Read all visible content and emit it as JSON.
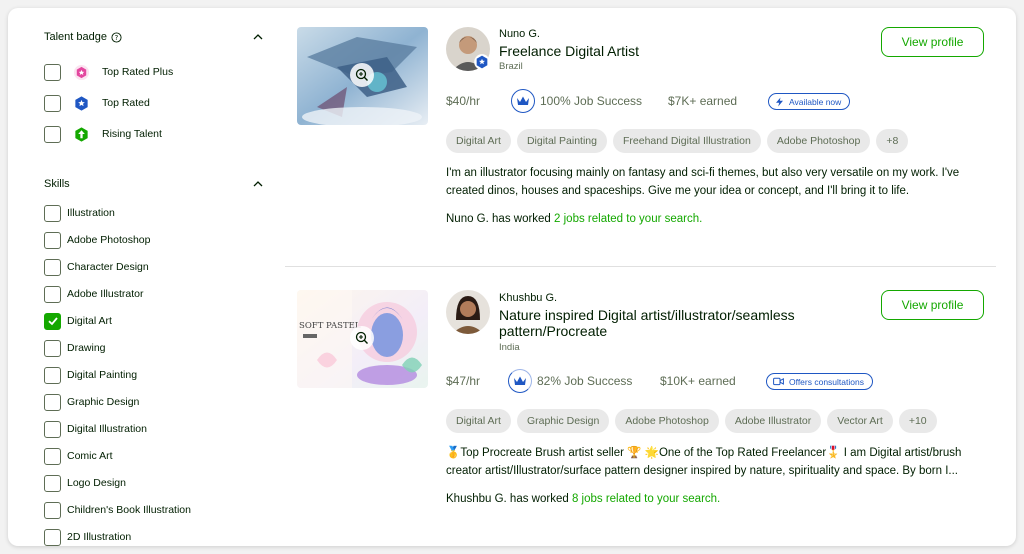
{
  "filters": {
    "talent_badge": {
      "title": "Talent badge",
      "options": [
        {
          "label": "Top Rated Plus",
          "icon": "top-rated-plus-icon",
          "color": "#e3469e",
          "checked": false
        },
        {
          "label": "Top Rated",
          "icon": "top-rated-icon",
          "color": "#1f57c3",
          "checked": false
        },
        {
          "label": "Rising Talent",
          "icon": "rising-talent-icon",
          "color": "#14a800",
          "checked": false
        }
      ]
    },
    "skills": {
      "title": "Skills",
      "options": [
        {
          "label": "Illustration",
          "checked": false
        },
        {
          "label": "Adobe Photoshop",
          "checked": false
        },
        {
          "label": "Character Design",
          "checked": false
        },
        {
          "label": "Adobe Illustrator",
          "checked": false
        },
        {
          "label": "Digital Art",
          "checked": true
        },
        {
          "label": "Drawing",
          "checked": false
        },
        {
          "label": "Digital Painting",
          "checked": false
        },
        {
          "label": "Graphic Design",
          "checked": false
        },
        {
          "label": "Digital Illustration",
          "checked": false
        },
        {
          "label": "Comic Art",
          "checked": false
        },
        {
          "label": "Logo Design",
          "checked": false
        },
        {
          "label": "Children's Book Illustration",
          "checked": false
        },
        {
          "label": "2D Illustration",
          "checked": false
        }
      ]
    }
  },
  "freelancers": [
    {
      "name": "Nuno G.",
      "title": "Freelance Digital Artist",
      "country": "Brazil",
      "rate": "$40/hr",
      "job_success": "100% Job Success",
      "earned": "$7K+ earned",
      "availability": "Available now",
      "view_label": "View profile",
      "tags": [
        "Digital Art",
        "Digital Painting",
        "Freehand Digital Illustration",
        "Adobe Photoshop",
        "+8"
      ],
      "description": "I'm an illustrator focusing mainly on fantasy and sci-fi themes, but also very versatile on my work. I've created dinos, houses and spaceships. Give me your idea or concept, and I'll bring it to life.",
      "worked_prefix": "Nuno G. has worked ",
      "worked_link": "2 jobs related to your search."
    },
    {
      "name": "Khushbu G.",
      "title": "Nature inspired Digital artist/illustrator/seamless pattern/Procreate",
      "country": "India",
      "rate": "$47/hr",
      "job_success": "82% Job Success",
      "earned": "$10K+ earned",
      "availability": "Offers consultations",
      "view_label": "View profile",
      "thumb_text": "SOFT PASTEL",
      "tags": [
        "Digital Art",
        "Graphic Design",
        "Adobe Photoshop",
        "Adobe Illustrator",
        "Vector Art",
        "+10"
      ],
      "description": "🥇Top Procreate Brush artist seller 🏆 🌟One of the Top Rated Freelancer🎖️ I am Digital artist/brush creator artist/Illustrator/surface pattern designer inspired by nature, spirituality and space. By born I...",
      "worked_prefix": "Khushbu G. has worked ",
      "worked_link": "8 jobs related to your search."
    }
  ],
  "colors": {
    "accent": "#14a800",
    "blue": "#1f57c3",
    "muted": "#5e6d55"
  }
}
